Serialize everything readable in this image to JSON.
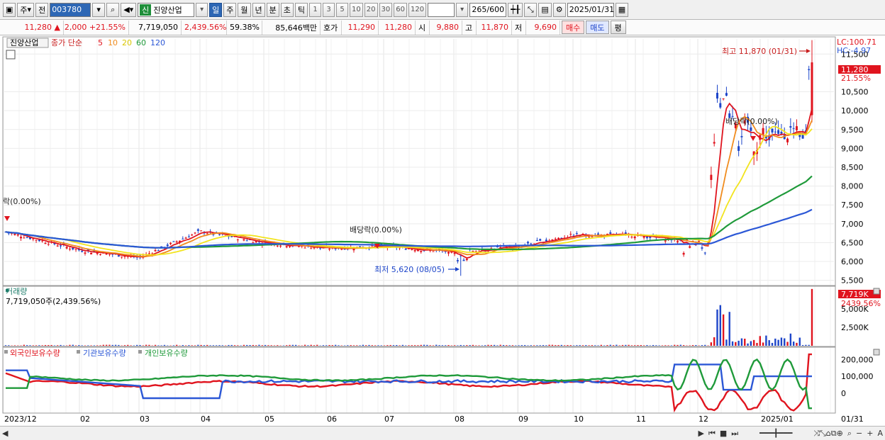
{
  "toolbar": {
    "period_prefix": "주",
    "code_label": "전",
    "code_value": "003780",
    "sin_badge": "신",
    "stock_name": "진양산업",
    "periods": [
      "일",
      "주",
      "월",
      "년",
      "분",
      "초",
      "틱"
    ],
    "active_period": "일",
    "intervals": [
      "1",
      "3",
      "5",
      "10",
      "20",
      "30",
      "60",
      "120"
    ],
    "count_value": "265",
    "count_total": "/600",
    "date_value": "2025/01/31"
  },
  "quote": {
    "price": "11,280",
    "change_arrow": "▲",
    "change": "2,000",
    "change_pct": "+21.55%",
    "volume": "7,719,050",
    "volume_pct": "2,439.56%",
    "turnover_pct": "59.38%",
    "amount": "85,646백만",
    "hoga_label": "호가",
    "ask": "11,290",
    "bid": "11,280",
    "open_label": "시",
    "open": "9,880",
    "high_label": "고",
    "high": "11,870",
    "low_label": "저",
    "low": "9,690",
    "buy_label": "매수",
    "sell_label": "매도",
    "eval_label": "평"
  },
  "price_panel": {
    "legend_name": "진양산업",
    "legend_type": "종가 단순",
    "ma_periods": [
      "5",
      "10",
      "20",
      "60",
      "120"
    ],
    "ma_colors": [
      "#e0141e",
      "#f08c1e",
      "#f2e41e",
      "#1f9a3a",
      "#2b57d6"
    ],
    "lc_label": "LC:100.71",
    "hc_label": "HC:-4.97",
    "high_annotation": "최고 11,870 (01/31)",
    "low_annotation": "최저 5,620 (08/05)",
    "dividend_labels": [
      "락(0.00%)",
      "배당락(0.00%)",
      "배당락(0.00%)"
    ],
    "current_price_tag": "11,280",
    "current_pct_tag": "21.55%",
    "y_ticks": [
      "11,500",
      "10,500",
      "10,000",
      "9,500",
      "9,000",
      "8,500",
      "8,000",
      "7,500",
      "7,000",
      "6,500",
      "6,000",
      "5,500"
    ]
  },
  "volume_panel": {
    "title": "거래량",
    "value_text": "7,719,050주(2,439.56%)",
    "tag_value": "7,719K",
    "tag_pct": "2439.56%",
    "y_ticks": [
      "5,000K",
      "2,500K"
    ]
  },
  "holding_panel": {
    "series_names": [
      "외국인보유수량",
      "기관보유수량",
      "개인보유수량"
    ],
    "series_colors": [
      "#e0141e",
      "#2b57d6",
      "#1f9a3a"
    ],
    "y_ticks": [
      "200,000",
      "100,000",
      "0"
    ]
  },
  "x_axis": {
    "labels": [
      "2023/12",
      "02",
      "03",
      "04",
      "05",
      "06",
      "07",
      "08",
      "09",
      "10",
      "11",
      "12",
      "2025/01"
    ],
    "right_label": "01/31"
  },
  "chart_data": {
    "type": "line",
    "title": "진양산업",
    "x": [
      "2023/12",
      "02",
      "03",
      "04",
      "05",
      "06",
      "07",
      "08",
      "09",
      "10",
      "11",
      "12",
      "2025/01",
      "01/31"
    ],
    "series": [
      {
        "name": "종가",
        "values": [
          6800,
          6300,
          6100,
          6800,
          6500,
          6350,
          6400,
          6250,
          6400,
          6700,
          6700,
          6500,
          9200,
          11280
        ]
      }
    ],
    "ylim": [
      5400,
      11900
    ],
    "high": 11870,
    "low": 5620,
    "volume_last": 7719050,
    "volume_ylim": [
      0,
      7800000
    ]
  }
}
